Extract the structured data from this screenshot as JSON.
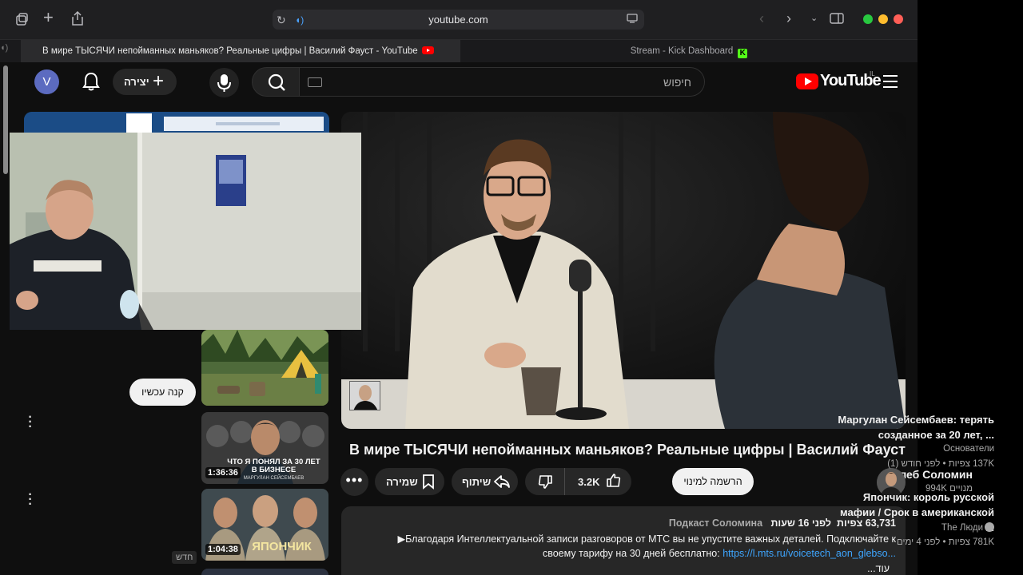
{
  "browser": {
    "url": "youtube.com",
    "tabs": [
      {
        "label": "В мире ТЫСЯЧИ непойманных маньяков? Реальные цифры | Василий Фауст - YouTube",
        "active": true
      },
      {
        "label": "Stream - Kick Dashboard",
        "active": false
      }
    ],
    "colors": {
      "close": "#ff5f57",
      "minimize": "#febc2e",
      "zoom": "#28c840"
    }
  },
  "header": {
    "avatar_letter": "V",
    "create_label": "יצירה",
    "search_placeholder": "חיפוש",
    "logo_text": "YouTube",
    "logo_region": "IL"
  },
  "video": {
    "title": "В мире ТЫСЯЧИ непойманных маньяков? Реальные цифры | Василий Фауст",
    "channel": "Глеб Соломин",
    "subscribers": "994K מנויים",
    "subscribe_label": "הרשמה למינוי",
    "likes": "3.2K",
    "share_label": "שיתוף",
    "save_label": "שמירה"
  },
  "description": {
    "views": "63,731 צפיות",
    "age": "לפני 16 שעות",
    "tag": "Подкаст Соломина",
    "line1": "▶Благодаря Интеллектуальной записи разговоров от МТС вы не упустите важных деталей. Подключайте к",
    "line2_text": "своему тарифу на 30 дней бесплатно: ",
    "line2_link": "https://l.mts.ru/voicetech_aon_glebso...",
    "more_label": "...עוד"
  },
  "sidebar": {
    "buy_label": "קנה עכשיו",
    "recommendations": [
      {
        "title": "Маргулан Сейсембаев: терять созданное за 20 лет, ...",
        "channel": "Основатели",
        "meta": "137K צפיות • לפני חודש (1)",
        "duration": "1:36:36",
        "thumb_text": "ЧТО Я ПОНЯЛ ЗА 30 ЛЕТ В БИЗНЕСЕ",
        "thumb_sub": "МАРГУЛАН СЕЙСЕМБАЕВ"
      },
      {
        "title": "Япончик: король русской мафии / Срок в американской ...",
        "channel": "The Люди",
        "meta": "781K צפיות • לפני 4 ימים",
        "duration": "1:04:38",
        "thumb_text": "ЯПОНЧИК",
        "badge": "חדש"
      }
    ]
  }
}
